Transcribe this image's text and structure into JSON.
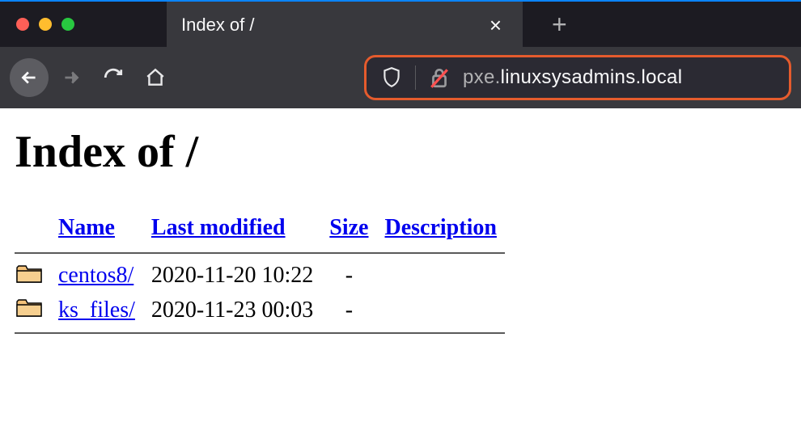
{
  "window": {
    "tab_title": "Index of /",
    "new_tab_label": "+",
    "close_tab_label": "×"
  },
  "addressbar": {
    "subdomain": "pxe.",
    "domain": "linuxsysadmins.local"
  },
  "page": {
    "heading": "Index of /",
    "columns": {
      "name": "Name",
      "last_modified": "Last modified",
      "size": "Size",
      "description": "Description"
    },
    "entries": [
      {
        "name": "centos8/",
        "last_modified": "2020-11-20 10:22",
        "size": "-",
        "description": ""
      },
      {
        "name": "ks_files/",
        "last_modified": "2020-11-23 00:03",
        "size": "-",
        "description": ""
      }
    ]
  }
}
